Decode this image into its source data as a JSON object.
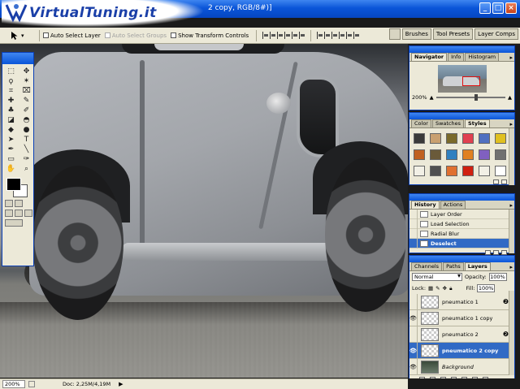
{
  "logo": {
    "text": "VirtualTuning.it"
  },
  "window": {
    "title": "2 copy, RGB/8#)]",
    "minimize_label": "_",
    "maximize_label": "□",
    "close_label": "×"
  },
  "options_bar": {
    "auto_select_layer": "Auto Select Layer",
    "auto_select_groups": "Auto Select Groups",
    "show_transform_controls": "Show Transform Controls",
    "wells": [
      "Brushes",
      "Tool Presets",
      "Layer Comps"
    ]
  },
  "toolbox": {
    "tools": [
      "marquee-icon",
      "move-icon",
      "lasso-icon",
      "magic-wand-icon",
      "crop-icon",
      "slice-icon",
      "healing-icon",
      "brush-icon",
      "stamp-icon",
      "history-brush-icon",
      "eraser-icon",
      "bucket-icon",
      "blur-icon",
      "dodge-icon",
      "path-select-icon",
      "type-icon",
      "pen-icon",
      "line-icon",
      "notes-icon",
      "eyedropper-icon",
      "hand-icon",
      "zoom-icon"
    ],
    "glyphs": [
      "⬚",
      "✥",
      "ϙ",
      "✶",
      "⌗",
      "⌧",
      "✚",
      "✎",
      "♣",
      "✐",
      "◪",
      "◓",
      "◆",
      "●",
      "➤",
      "T",
      "✒",
      "╲",
      "▭",
      "✑",
      "✋",
      "⌕"
    ],
    "foreground_color": "#000000",
    "background_color": "#ffffff"
  },
  "navigator": {
    "tabs": [
      "Navigator",
      "Info",
      "Histogram"
    ],
    "zoom": "200%"
  },
  "styles": {
    "tabs": [
      "Color",
      "Swatches",
      "Styles"
    ],
    "swatch_colors": [
      "#3a3a3a",
      "#c9a070",
      "#7a6a2a",
      "#e04050",
      "#5070c0",
      "#e0c020",
      "#c06020",
      "#6a5a3a",
      "#3080c0",
      "#e08020",
      "#8060c0",
      "#707070",
      "#f2f0e6",
      "#505050",
      "#e07030",
      "#d02010",
      "#f2f0e6",
      "#ffffff"
    ]
  },
  "history": {
    "tabs": [
      "History",
      "Actions"
    ],
    "items": [
      {
        "label": "Layer Order",
        "selected": false
      },
      {
        "label": "Load Selection",
        "selected": false
      },
      {
        "label": "Radial Blur",
        "selected": false
      },
      {
        "label": "Deselect",
        "selected": true
      }
    ]
  },
  "layers": {
    "tabs": [
      "Channels",
      "Paths",
      "Layers"
    ],
    "blend_mode": "Normal",
    "opacity_label": "Opacity:",
    "opacity": "100%",
    "lock_label": "Lock:",
    "fill_label": "Fill:",
    "fill": "100%",
    "items": [
      {
        "name": "pneumatico 1",
        "visible": false,
        "fx": true,
        "selected": false,
        "background": false
      },
      {
        "name": "pneumatico 1 copy",
        "visible": true,
        "fx": false,
        "selected": false,
        "background": false
      },
      {
        "name": "pneumatico 2",
        "visible": false,
        "fx": true,
        "selected": false,
        "background": false
      },
      {
        "name": "pneumatico 2 copy",
        "visible": true,
        "fx": false,
        "selected": true,
        "background": false
      },
      {
        "name": "Background",
        "visible": true,
        "fx": false,
        "selected": false,
        "background": true
      }
    ]
  },
  "status": {
    "zoom": "200%",
    "doc": "Doc: 2,25M/4,19M",
    "arrow": "▶"
  }
}
